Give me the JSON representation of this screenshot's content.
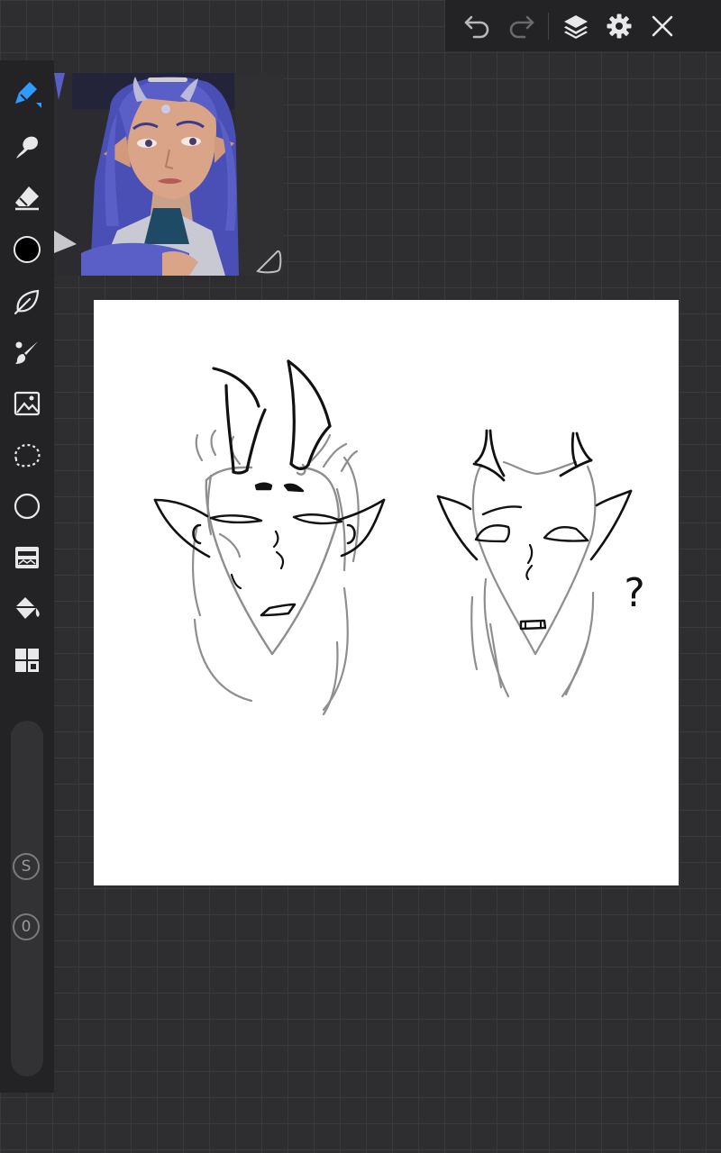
{
  "toolbar": {
    "undo": "undo-icon",
    "redo": "redo-icon",
    "layers": "layers-icon",
    "settings": "gear-icon",
    "close": "close-icon"
  },
  "tools": [
    "pen-icon",
    "smudge-icon",
    "eraser-icon",
    "color-swatch",
    "leaf-brush-icon",
    "brush-icon",
    "image-import-icon",
    "lasso-icon",
    "shape-icon",
    "filter-icon",
    "fill-bucket-icon",
    "grid-icon"
  ],
  "colors": {
    "active_tool": "#2f9bff",
    "current_color": "#000000",
    "hair": "#5a5fc8",
    "skin": "#d9a488"
  },
  "slider": {
    "size_label": "S",
    "opacity_label": "0"
  },
  "canvas": {
    "annotation": "?"
  }
}
